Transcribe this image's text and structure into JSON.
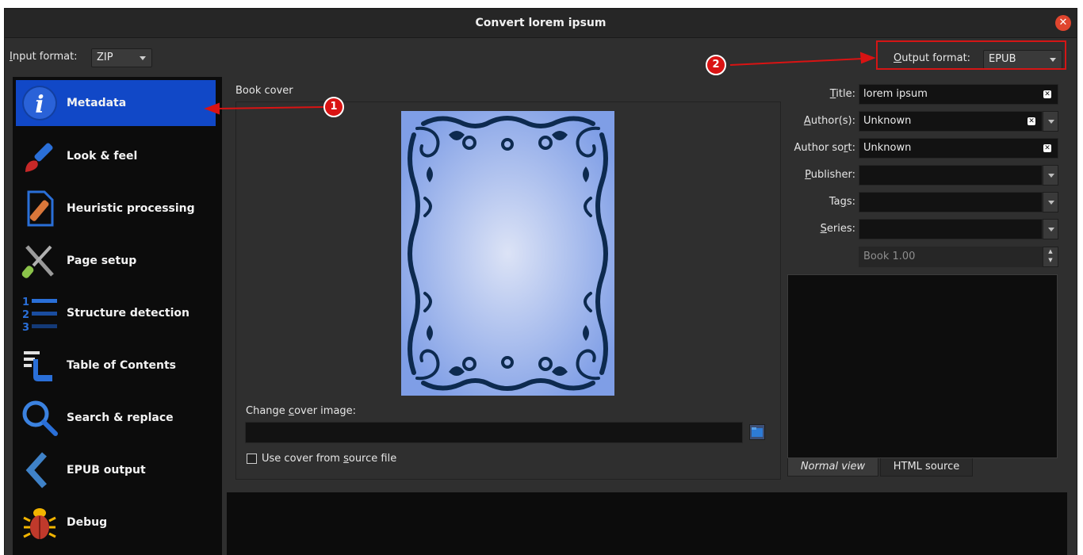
{
  "window": {
    "title": "Convert lorem ipsum"
  },
  "input_format": {
    "label": "Input format:",
    "value": "ZIP"
  },
  "output_format": {
    "label": "Output format:",
    "value": "EPUB"
  },
  "sidebar": {
    "items": [
      {
        "label": "Metadata",
        "icon": "info-icon",
        "active": true
      },
      {
        "label": "Look & feel",
        "icon": "paintbrush-icon"
      },
      {
        "label": "Heuristic processing",
        "icon": "document-bandage-icon"
      },
      {
        "label": "Page setup",
        "icon": "tools-icon"
      },
      {
        "label": "Structure detection",
        "icon": "numbered-list-icon"
      },
      {
        "label": "Table of Contents",
        "icon": "toc-icon"
      },
      {
        "label": "Search & replace",
        "icon": "magnifier-icon"
      },
      {
        "label": "EPUB output",
        "icon": "epub-chevron-icon"
      },
      {
        "label": "Debug",
        "icon": "bug-icon"
      }
    ]
  },
  "book_cover": {
    "title": "Book cover",
    "change_label": "Change cover image:",
    "path_value": "",
    "use_source_label": "Use cover from source file",
    "use_source_checked": false
  },
  "metadata": {
    "title_label": "Title:",
    "title_value": "lorem ipsum",
    "authors_label": "Author(s):",
    "authors_value": "Unknown",
    "author_sort_label": "Author sort:",
    "author_sort_value": "Unknown",
    "publisher_label": "Publisher:",
    "publisher_value": "",
    "tags_label": "Tags:",
    "tags_value": "",
    "series_label": "Series:",
    "series_value": "",
    "series_index_value": "Book 1.00"
  },
  "comments_tabs": [
    "Normal view",
    "HTML source"
  ],
  "annotations": [
    "1",
    "2"
  ],
  "colors": {
    "accent": "#1148c7",
    "annotation": "#d91313",
    "close_button": "#e0452e",
    "window_bg": "#2f2f2f",
    "sidebar_bg": "#0c0c0c"
  }
}
